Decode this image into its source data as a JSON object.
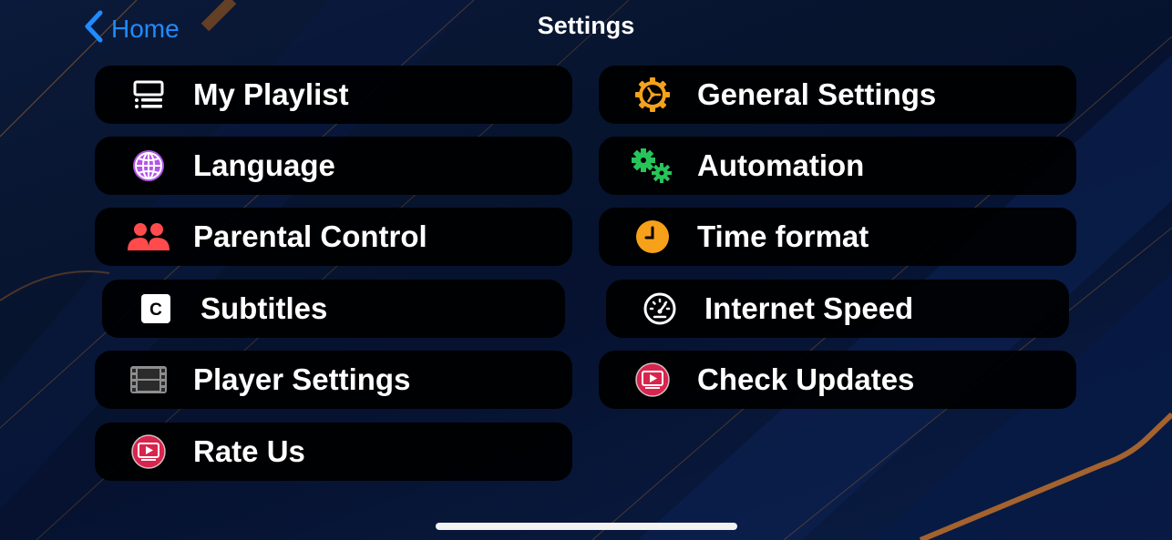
{
  "header": {
    "back_label": "Home",
    "title": "Settings"
  },
  "menu": {
    "left": [
      {
        "label": "My Playlist",
        "icon": "playlist-icon"
      },
      {
        "label": "Language",
        "icon": "globe-icon"
      },
      {
        "label": "Parental Control",
        "icon": "users-icon"
      },
      {
        "label": "Subtitles",
        "icon": "subtitles-icon"
      },
      {
        "label": "Player Settings",
        "icon": "film-strip-icon"
      },
      {
        "label": "Rate Us",
        "icon": "app-logo-icon"
      }
    ],
    "right": [
      {
        "label": "General Settings",
        "icon": "gear-icon"
      },
      {
        "label": "Automation",
        "icon": "gears-icon"
      },
      {
        "label": "Time format",
        "icon": "clock-icon"
      },
      {
        "label": "Internet Speed",
        "icon": "speedometer-icon"
      },
      {
        "label": "Check Updates",
        "icon": "app-logo-icon"
      }
    ]
  },
  "colors": {
    "accent_blue": "#1f8bff",
    "gear_orange": "#f5a21b",
    "automation_green": "#27c45a",
    "clock_orange": "#f7a11a",
    "parental_red": "#ff4b4b",
    "language_purple": "#b455e8",
    "logo_red": "#d8254e"
  }
}
